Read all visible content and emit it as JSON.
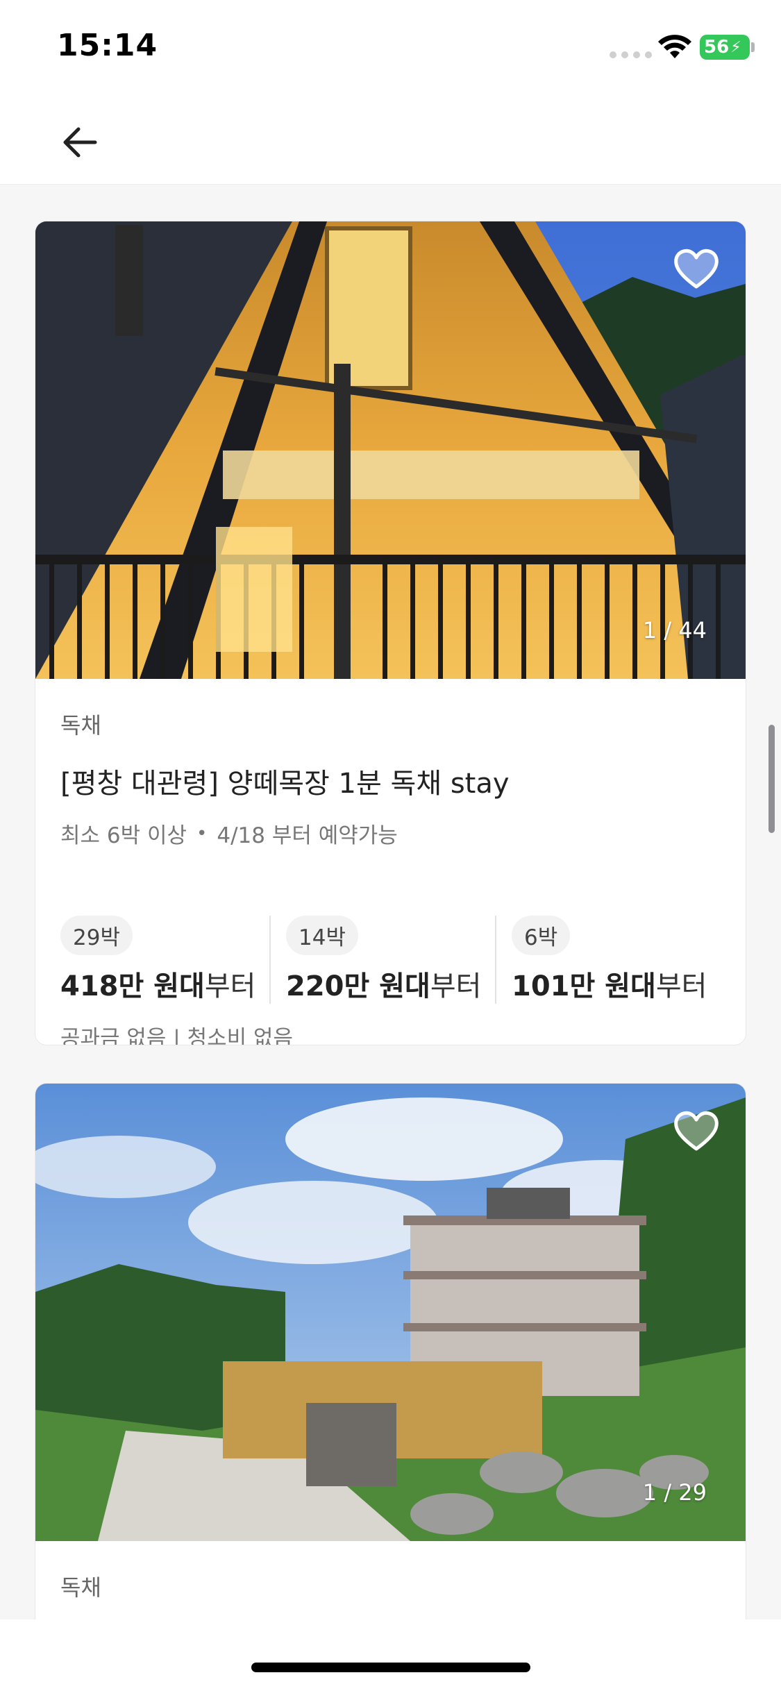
{
  "status_bar": {
    "time": "15:14",
    "battery": "56"
  },
  "nav": {
    "back_icon": "arrow-left-icon"
  },
  "listings": [
    {
      "photo_counter": "1 / 44",
      "category": "독채",
      "title": "[평창 대관령] 양떼목장 1분 독채 stay",
      "min_stay": "최소 6박 이상",
      "available": "4/18 부터 예약가능",
      "prices": [
        {
          "nights": "29박",
          "amount": "418만 원대",
          "suffix": "부터"
        },
        {
          "nights": "14박",
          "amount": "220만 원대",
          "suffix": "부터"
        },
        {
          "nights": "6박",
          "amount": "101만 원대",
          "suffix": "부터"
        }
      ],
      "fees": "공과금 없음 | 청소비 없음"
    },
    {
      "photo_counter": "1 / 29",
      "category": "독채"
    }
  ]
}
